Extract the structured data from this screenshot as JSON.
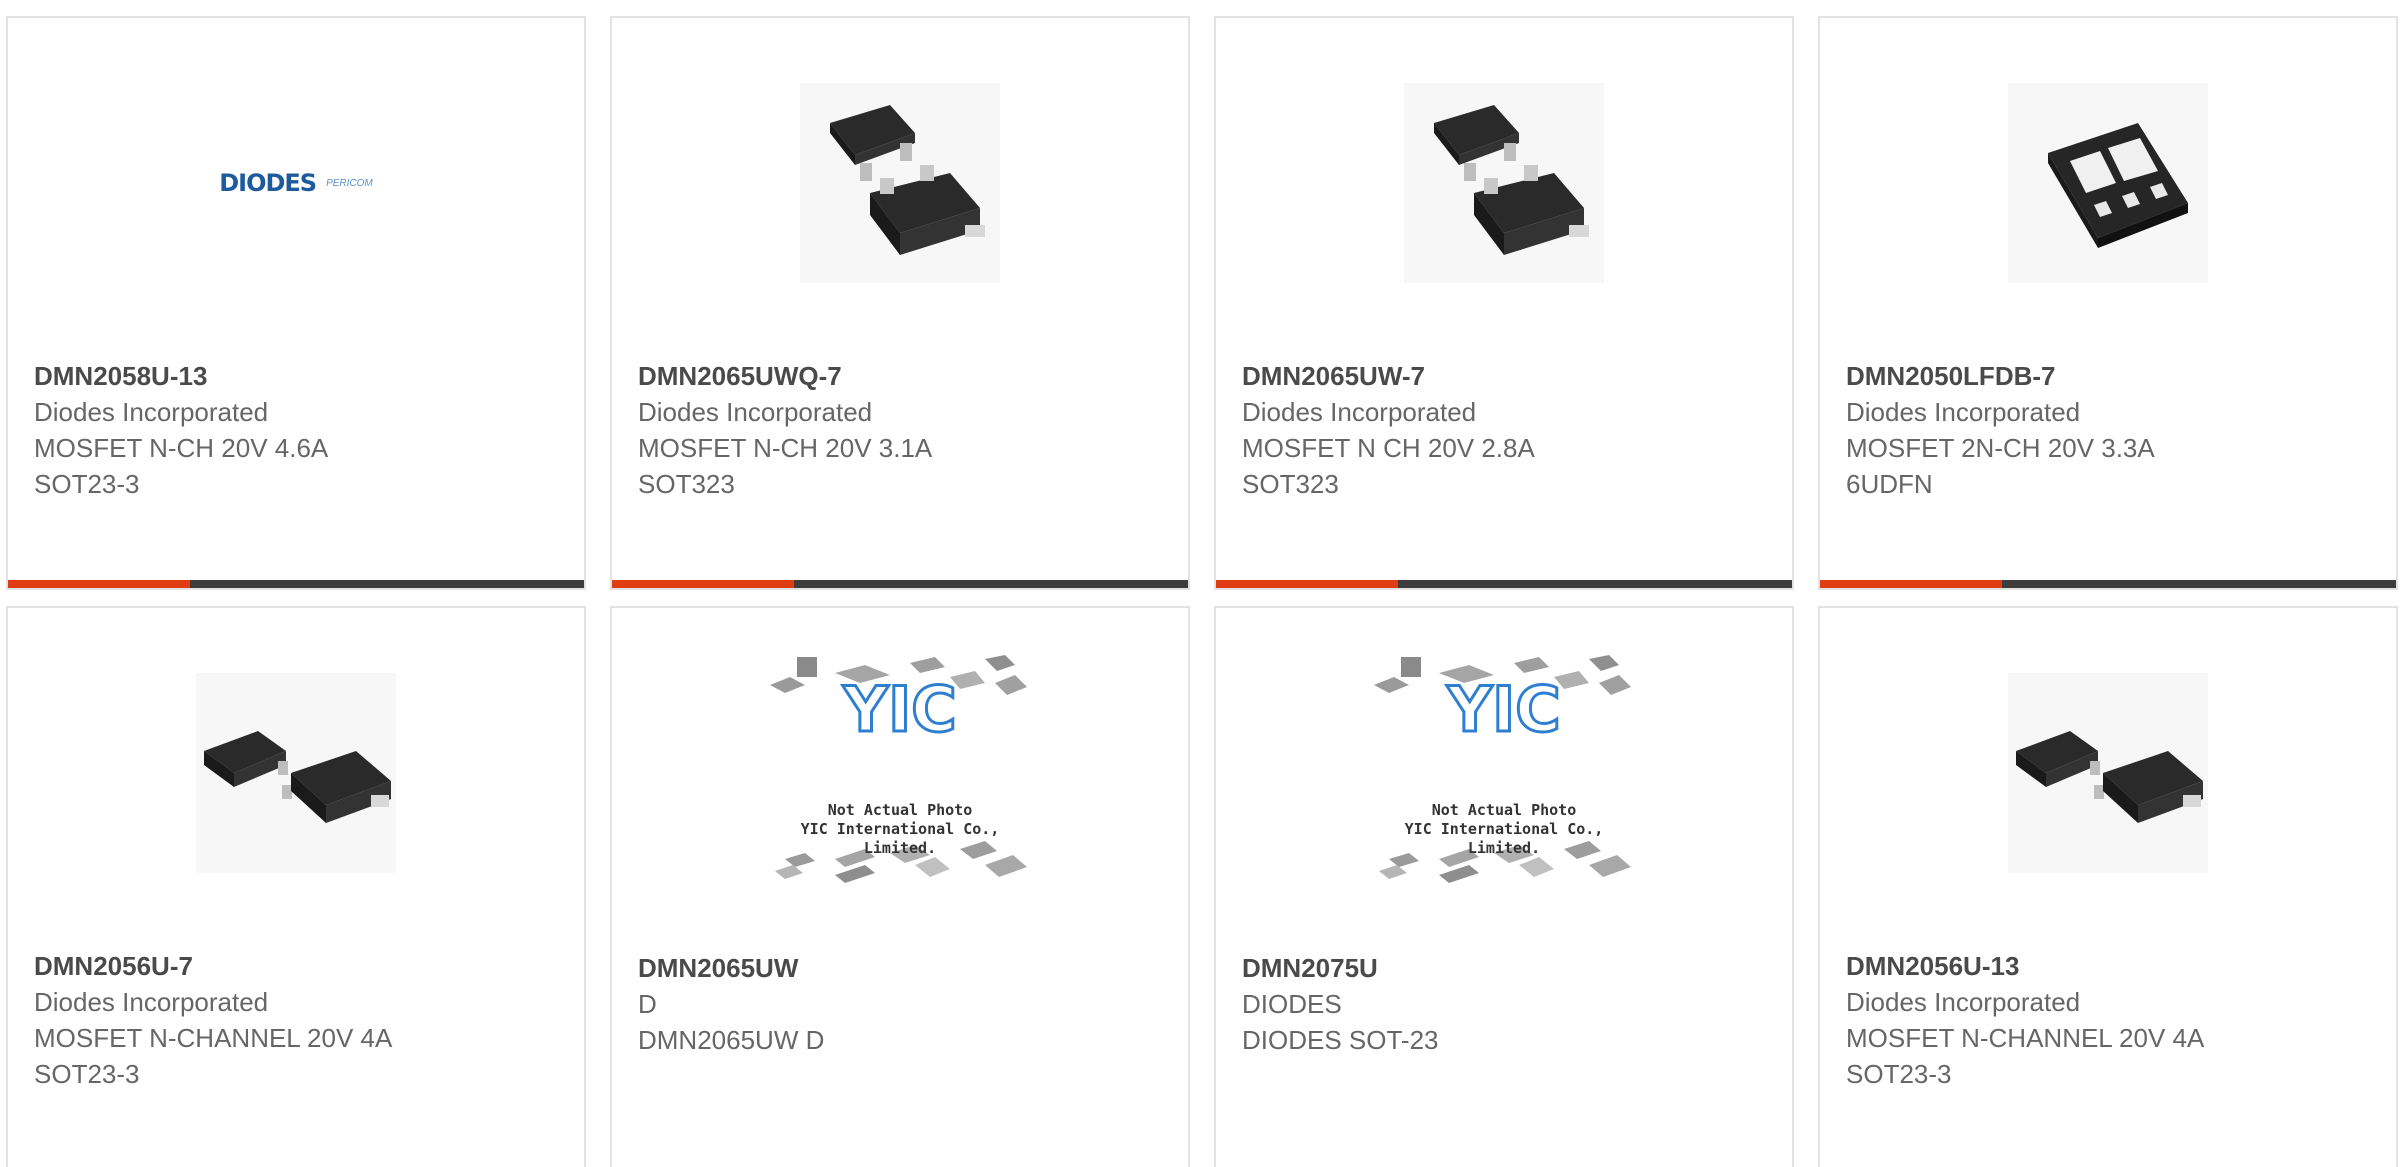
{
  "products": [
    {
      "part_number": "DMN2058U-13",
      "manufacturer": "Diodes Incorporated",
      "description": "MOSFET N-CH 20V 4.6A",
      "package": "SOT23-3",
      "image": "diodes-logo",
      "logo_text": "DIODES",
      "logo_sub": "PERICOM"
    },
    {
      "part_number": "DMN2065UWQ-7",
      "manufacturer": "Diodes Incorporated",
      "description": "MOSFET N-CH 20V 3.1A",
      "package": "SOT323",
      "image": "sot323-package-photo"
    },
    {
      "part_number": "DMN2065UW-7",
      "manufacturer": "Diodes Incorporated",
      "description": "MOSFET N CH 20V 2.8A",
      "package": "SOT323",
      "image": "sot323-package-photo"
    },
    {
      "part_number": "DMN2050LFDB-7",
      "manufacturer": "Diodes Incorporated",
      "description": "MOSFET 2N-CH 20V 3.3A",
      "package": "6UDFN",
      "image": "udfn-package-photo"
    },
    {
      "part_number": "DMN2056U-7",
      "manufacturer": "Diodes Incorporated",
      "description": "MOSFET N-CHANNEL 20V 4A",
      "package": "SOT23-3",
      "image": "sot23-package-photo"
    },
    {
      "part_number": "DMN2065UW",
      "manufacturer": "D",
      "description": "DMN2065UW D",
      "package": "",
      "image": "yic-placeholder",
      "placeholder_line1": "Not Actual Photo",
      "placeholder_line2": "YIC International Co., Limited."
    },
    {
      "part_number": "DMN2075U",
      "manufacturer": "DIODES",
      "description": "DIODES SOT-23",
      "package": "",
      "image": "yic-placeholder",
      "placeholder_line1": "Not Actual Photo",
      "placeholder_line2": "YIC International Co., Limited."
    },
    {
      "part_number": "DMN2056U-13",
      "manufacturer": "Diodes Incorporated",
      "description": "MOSFET N-CHANNEL 20V 4A",
      "package": "SOT23-3",
      "image": "sot23-package-photo"
    }
  ],
  "colors": {
    "accent": "#e03d12",
    "bar": "#3d3d3d",
    "border": "#e2e2e2",
    "part_text": "#4a4a4a",
    "body_text": "#666666"
  }
}
